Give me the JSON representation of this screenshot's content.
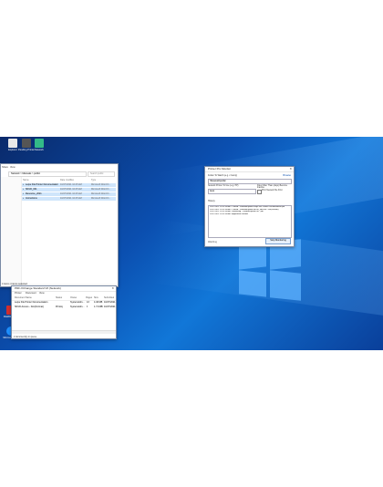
{
  "desktop": {
    "icons": [
      {
        "label": "Explorer",
        "color": "#e8e8e8"
      },
      {
        "label": "Pending Printer",
        "color": "#555"
      },
      {
        "label": "Network",
        "color": "#3b8"
      },
      {
        "label": "Network Printer",
        "color": "#c0392b"
      },
      {
        "label": "FileZilla Client",
        "color": "#d32f2f"
      },
      {
        "label": "Microsoft Edge",
        "color": "#1e90ff"
      },
      {
        "label": "Google Chrome",
        "color": "#e53935"
      }
    ]
  },
  "explorer": {
    "title": "",
    "menu": [
      "Share",
      "View"
    ],
    "address": "Network > Manuals > public",
    "search_placeholder": "Search public",
    "columns": [
      "Name",
      "Date modified",
      "Type"
    ],
    "files": [
      {
        "name": "Leipe File Printer Documentation",
        "date": "10/27/2021 10:25 AM",
        "type": "Microsoft Word D...",
        "selected": true
      },
      {
        "name": "SKUD_001",
        "date": "10/27/2021 10:25 AM",
        "type": "Microsoft Word D...",
        "selected": true
      },
      {
        "name": "Resource_2021",
        "date": "10/27/2021 10:25 AM",
        "type": "Microsoft Word D...",
        "selected": true
      },
      {
        "name": "Instructions",
        "date": "10/27/2021 10:25 AM",
        "type": "Microsoft Word D...",
        "selected": true
      }
    ],
    "status": "4 items  4 items selected"
  },
  "printwin": {
    "title": "PDF-XChange Standard V6 (Network)",
    "menu": [
      "Printer",
      "Document",
      "View"
    ],
    "columns": [
      "Document Name",
      "Status",
      "Owner",
      "Pages",
      "Size",
      "Submitted"
    ],
    "rows": [
      {
        "doc": "Leipe File Printer Documentation",
        "status": "",
        "owner": "SystemAdm...",
        "pages": "13",
        "size": "4.46 MB",
        "submitted": "10/27/2021 10:25:11 AM"
      },
      {
        "doc": "SKUD Access - Doc(Format)",
        "status": "Printing",
        "owner": "SystemAdm...",
        "pages": "9",
        "size": "1.71 MB/1.78 MB",
        "submitted": "10/27/2021 10:25:33 AM"
      }
    ],
    "status": "2 document(s) in queue"
  },
  "dialog": {
    "title": "Printer Pro Monitor",
    "folder_label": "Folder To Watch (e.g. c:\\temp)",
    "browse": "Browse",
    "folder_value": "\\\\Network\\public",
    "printer_label": "Network Printer To Use (e.g. HP)",
    "printer_value": "Auto",
    "delete_label": "Files Older Than (days) Become Inactive",
    "checkbox_label": "Print Newest File First",
    "history_label": "History",
    "log": [
      "10/27/2021 10:25:33 AM - Printed - \\\\Network\\public\\Leipe File Printer Documentation.pdf",
      "10/27/2021 10:25:33 AM - Printed - \\\\Network\\public\\SKUD_Access - Doc(Format)",
      "10/27/2021 10:25:33 AM - Monitoring - \\\\Network\\public for *.pdf",
      "10/27/2021 10:25:33 AM - Application Started"
    ],
    "status": "Watching",
    "stop_button": "Stop Monitoring"
  },
  "colors": {
    "accent": "#0b4fb0",
    "selection": "#cfe5fb"
  }
}
